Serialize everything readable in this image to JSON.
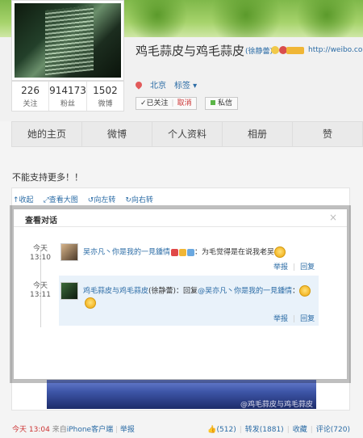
{
  "profile": {
    "name": "鸡毛蒜皮与鸡毛蒜皮",
    "nick": "(徐静蕾)",
    "url": "http://weibo.com",
    "location": "北京",
    "tags_label": "标签",
    "followed_label": "✓已关注",
    "cancel_label": "取消",
    "msg_label": "私信",
    "stats": [
      {
        "num": "226",
        "label": "关注"
      },
      {
        "num": "914173",
        "label": "粉丝"
      },
      {
        "num": "1502",
        "label": "微博"
      }
    ]
  },
  "tabs": [
    "她的主页",
    "微博",
    "个人资料",
    "相册",
    "赞"
  ],
  "tip": "不能支持更多！！",
  "photo_tools": [
    "收起",
    "查看大图",
    "向左转",
    "向右转"
  ],
  "photo_watermark": "@鸡毛蒜皮与鸡毛蒜皮",
  "dialog": {
    "title": "查看对话",
    "close": "×",
    "entries": [
      {
        "time_day": "今天",
        "time_clock": "13:10",
        "user": "吴亦凡丶你是我的一見鍾情",
        "text": "：为毛觉得是在说我老吴",
        "actions": [
          "举报",
          "回复"
        ]
      },
      {
        "time_day": "今天",
        "time_clock": "13:11",
        "user": "鸡毛蒜皮与鸡毛蒜皮",
        "nick": "(徐静蕾)",
        "reply_prefix": "：回复",
        "reply_to": "@吴亦凡丶你是我的一見鍾情",
        "reply_suffix": "：",
        "actions": [
          "举报",
          "回复"
        ]
      }
    ]
  },
  "footer": {
    "time": "今天 13:04",
    "source_prefix": "来自",
    "source": "iPhone客户端",
    "report": "举报",
    "like": "(512)",
    "repost": "转发(1881)",
    "fav": "收藏",
    "comment": "评论(720)"
  }
}
